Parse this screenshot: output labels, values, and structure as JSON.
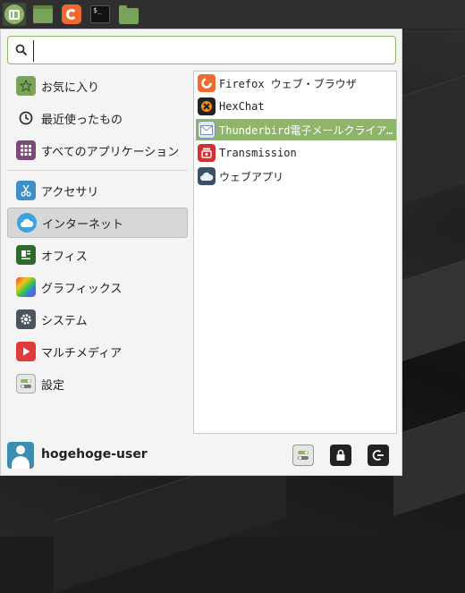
{
  "panel": {
    "launchers": [
      {
        "name": "mint-menu-icon"
      },
      {
        "name": "window-icon"
      },
      {
        "name": "firefox-icon"
      },
      {
        "name": "terminal-icon",
        "glyph": "$_"
      },
      {
        "name": "folder-icon"
      }
    ]
  },
  "search": {
    "value": "",
    "placeholder": ""
  },
  "categories": [
    {
      "label": "お気に入り",
      "icon": "star-icon"
    },
    {
      "label": "最近使ったもの",
      "icon": "clock-icon"
    },
    {
      "label": "すべてのアプリケーション",
      "icon": "grid-icon"
    },
    {
      "label": "アクセサリ",
      "icon": "scissors-icon"
    },
    {
      "label": "インターネット",
      "icon": "cloud-icon",
      "active": true
    },
    {
      "label": "オフィス",
      "icon": "document-icon"
    },
    {
      "label": "グラフィックス",
      "icon": "palette-icon"
    },
    {
      "label": "システム",
      "icon": "gear-icon"
    },
    {
      "label": "マルチメディア",
      "icon": "play-icon"
    },
    {
      "label": "設定",
      "icon": "toggles-icon"
    }
  ],
  "apps": [
    {
      "label": "Firefox ウェブ・ブラウザ",
      "icon": "firefox-icon"
    },
    {
      "label": "HexChat",
      "icon": "hexchat-icon"
    },
    {
      "label": "Thunderbird電子メールクライアント",
      "icon": "thunderbird-icon",
      "selected": true
    },
    {
      "label": "Transmission",
      "icon": "transmission-icon"
    },
    {
      "label": "ウェブアプリ",
      "icon": "webapp-icon"
    }
  ],
  "user": {
    "name": "hogehoge-user"
  },
  "colors": {
    "accent": "#8fb56a",
    "active_bg": "#d7d7d7"
  }
}
